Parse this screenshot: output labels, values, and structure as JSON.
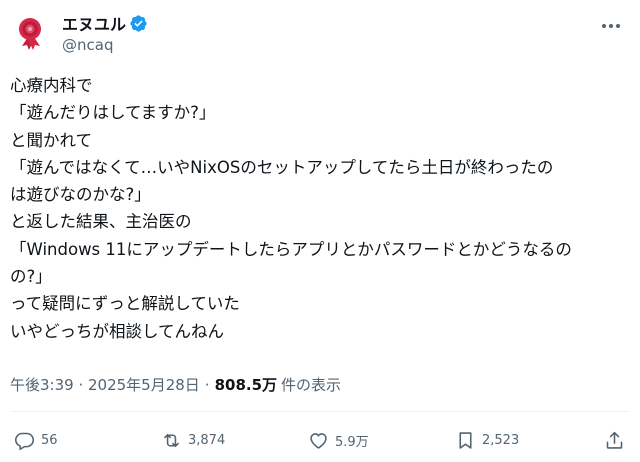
{
  "author": {
    "display_name": "エヌユル",
    "handle": "@ncaq",
    "avatar_icon": "ribbon-avatar-icon",
    "verified_icon": "verified-badge-icon",
    "verified_color": "#1d9bf0"
  },
  "tweet": {
    "lines": [
      "心療内科で",
      "「遊んだりはしてますか?」",
      "と聞かれて",
      "「遊んではなくて…いやNixOSのセットアップしてたら土日が終わったの",
      "は遊びなのかな?」",
      "と返した結果、主治医の",
      "「Windows 11にアップデートしたらアプリとかパスワードとかどうなるの",
      "の?」",
      "って疑問にずっと解説していた",
      "いやどっちが相談してんねん"
    ]
  },
  "meta": {
    "time": "午後3:39 · 2025年5月28日",
    "separator": "·",
    "views_count": "808.5万",
    "views_label": "件の表示"
  },
  "actions": {
    "reply": {
      "icon": "reply-icon",
      "count": "56"
    },
    "repost": {
      "icon": "repost-icon",
      "count": "3,874"
    },
    "like": {
      "icon": "heart-icon",
      "count": "5.9万"
    },
    "bookmark": {
      "icon": "bookmark-icon",
      "count": "2,523"
    },
    "share": {
      "icon": "share-icon"
    }
  },
  "colors": {
    "text": "#0f1419",
    "secondary": "#536471",
    "divider": "#eff3f4",
    "avatar_ribbon": "#d6284a"
  }
}
